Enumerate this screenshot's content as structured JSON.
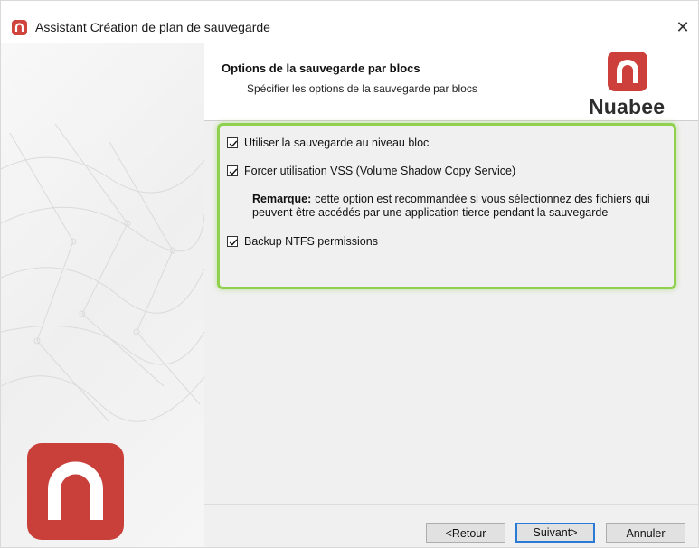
{
  "window": {
    "title": "Assistant Création de plan de sauvegarde",
    "close_glyph": "✕"
  },
  "header": {
    "title": "Options de la sauvegarde par blocs",
    "subtitle": "Spécifier les options de la sauvegarde par blocs",
    "brand_name": "Nuabee",
    "brand_color": "#cc3f3a"
  },
  "options": {
    "highlight_color": "#8fd14f",
    "items": [
      {
        "label": "Utiliser la sauvegarde au niveau bloc",
        "checked": true
      },
      {
        "label": "Forcer utilisation VSS (Volume Shadow Copy Service)",
        "checked": true
      },
      {
        "label": "Backup NTFS permissions",
        "checked": true
      }
    ],
    "note_label": "Remarque:",
    "note_text": "cette option est recommandée si vous sélectionnez des fichiers qui peuvent être accédés par une application tierce pendant la sauvegarde"
  },
  "buttons": {
    "back": "<Retour",
    "next": "Suivant>",
    "cancel": "Annuler"
  },
  "icons": {
    "app": "nuabee-logo-icon",
    "close": "close-icon",
    "check": "check-icon"
  }
}
